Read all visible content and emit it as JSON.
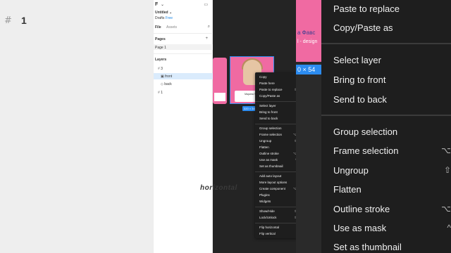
{
  "left_bg": {
    "hash_glyph": "#",
    "number": "1"
  },
  "panel": {
    "logo": "F",
    "logo_caret": "⌄",
    "title": "Untitled",
    "title_caret": "⌄",
    "drafts": "Drafts",
    "free": "Free",
    "tabs": {
      "file": "File",
      "assets": "Assets"
    },
    "pages_title": "Pages",
    "page_item": "Page 1",
    "layers_title": "Layers",
    "layers": [
      {
        "name": "3",
        "type": "frame"
      },
      {
        "name": "front",
        "type": "image"
      },
      {
        "name": "back",
        "type": "component"
      },
      {
        "name": "1",
        "type": "frame"
      }
    ]
  },
  "canvas": {
    "card_name": "Марина Фавс",
    "dim_badge": "320 × 34",
    "watermark": "horizontal"
  },
  "context_menu": {
    "groups": [
      [
        {
          "label": "Copy",
          "shortcut": ""
        },
        {
          "label": "Paste here",
          "shortcut": ""
        },
        {
          "label": "Paste to replace",
          "shortcut": "⇧"
        },
        {
          "label": "Copy/Paste as",
          "shortcut": ""
        }
      ],
      [
        {
          "label": "Select layer",
          "shortcut": ""
        },
        {
          "label": "Bring to front",
          "shortcut": ""
        },
        {
          "label": "Send to back",
          "shortcut": ""
        }
      ],
      [
        {
          "label": "Group selection",
          "shortcut": ""
        },
        {
          "label": "Frame selection",
          "shortcut": "⌥"
        },
        {
          "label": "Ungroup",
          "shortcut": "⇧"
        },
        {
          "label": "Flatten",
          "shortcut": ""
        },
        {
          "label": "Outline stroke",
          "shortcut": "⌥"
        },
        {
          "label": "Use as mask",
          "shortcut": "^"
        },
        {
          "label": "Set as thumbnail",
          "shortcut": ""
        }
      ],
      [
        {
          "label": "Add auto layout",
          "shortcut": ""
        },
        {
          "label": "More layout options",
          "shortcut": ""
        },
        {
          "label": "Create component",
          "shortcut": "⌥"
        },
        {
          "label": "Plugins",
          "shortcut": ""
        },
        {
          "label": "Widgets",
          "shortcut": ""
        }
      ],
      [
        {
          "label": "Show/Hide",
          "shortcut": "⇧"
        },
        {
          "label": "Lock/Unlock",
          "shortcut": "⇧"
        }
      ],
      [
        {
          "label": "Flip horizontal",
          "shortcut": ""
        },
        {
          "label": "Flip vertical",
          "shortcut": ""
        }
      ]
    ]
  },
  "zoom": {
    "art_text_1": "а Фавс",
    "art_text_2": "l - design",
    "badge": "0 × 54",
    "items": [
      {
        "label": "Paste to replace",
        "shortcut": ""
      },
      {
        "label": "Copy/Paste as",
        "shortcut": ""
      },
      {
        "label": "Select layer",
        "shortcut": ""
      },
      {
        "label": "Bring to front",
        "shortcut": ""
      },
      {
        "label": "Send to back",
        "shortcut": ""
      },
      {
        "label": "Group selection",
        "shortcut": ""
      },
      {
        "label": "Frame selection",
        "shortcut": "⌥"
      },
      {
        "label": "Ungroup",
        "shortcut": "⇧"
      },
      {
        "label": "Flatten",
        "shortcut": ""
      },
      {
        "label": "Outline stroke",
        "shortcut": "⌥"
      },
      {
        "label": "Use as mask",
        "shortcut": "^"
      },
      {
        "label": "Set as thumbnail",
        "shortcut": ""
      }
    ]
  },
  "colors": {
    "accent": "#2c8cf0",
    "card_pink": "#f06aa2",
    "menu_bg": "#1e1e1e"
  }
}
